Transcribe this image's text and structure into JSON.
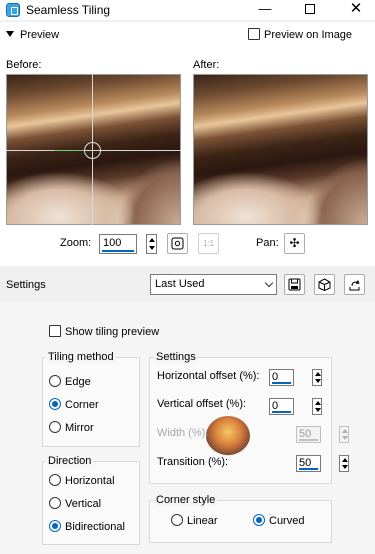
{
  "window": {
    "title": "Seamless Tiling",
    "minimize": "—",
    "close": "✕"
  },
  "preview": {
    "header": "Preview",
    "preview_on_image": "Preview on Image",
    "before_label": "Before:",
    "after_label": "After:",
    "zoom_label": "Zoom:",
    "zoom_value": "100",
    "pan_label": "Pan:",
    "fit_icon": "fit-view-icon",
    "actual_size_icon": "actual-size-icon",
    "actual_size_text": "1:1",
    "pan_icon": "pan-move-icon",
    "pan_glyph": "✣"
  },
  "settings_bar": {
    "label": "Settings",
    "preset_value": "Last Used",
    "save_icon": "save-disk-icon",
    "random_icon": "randomize-dice-icon",
    "reset_icon": "reset-icon"
  },
  "options": {
    "show_tiling_preview": "Show tiling preview",
    "tiling_method": {
      "title": "Tiling method",
      "options": [
        "Edge",
        "Corner",
        "Mirror"
      ],
      "selected": "Corner"
    },
    "direction": {
      "title": "Direction",
      "options": [
        "Horizontal",
        "Vertical",
        "Bidirectional"
      ],
      "selected": "Bidirectional"
    },
    "settings": {
      "title": "Settings",
      "horizontal_offset_label": "Horizontal offset (%):",
      "horizontal_offset_value": "0",
      "vertical_offset_label": "Vertical offset (%):",
      "vertical_offset_value": "0",
      "width_label": "Width (%):",
      "width_value": "50",
      "transition_label": "Transition (%):",
      "transition_value": "50"
    },
    "corner_style": {
      "title": "Corner style",
      "options": [
        "Linear",
        "Curved"
      ],
      "selected": "Curved"
    }
  },
  "colors": {
    "accent": "#0067c0",
    "panel_bg": "#ffffff",
    "window_bg": "#f0f0f0"
  }
}
